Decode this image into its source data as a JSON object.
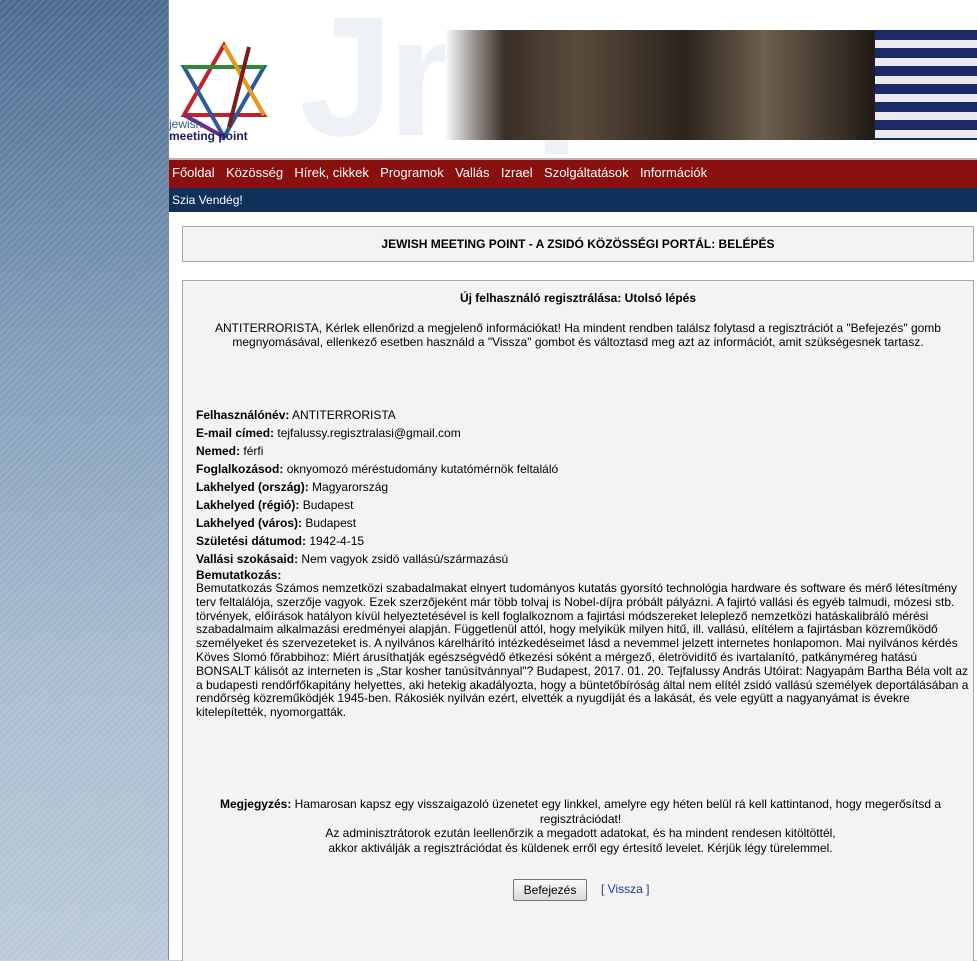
{
  "logo": {
    "line1": "jewish",
    "line2": "meeting point"
  },
  "nav": [
    "Főoldal",
    "Közösség",
    "Hírek, cikkek",
    "Programok",
    "Vallás",
    "Izrael",
    "Szolgáltatások",
    "Információk"
  ],
  "greeting": "Szia Vendég!",
  "page_title": "JEWISH MEETING POINT - A ZSIDÓ KÖZÖSSÉGI PORTÁL: BELÉPÉS",
  "step_title": "Új felhasználó regisztrálása: Utolsó lépés",
  "intro": "ANTITERRORISTA, Kérlek ellenőrizd a megjelenő információkat! Ha mindent rendben találsz folytasd a regisztrációt a \"Befejezés\" gomb megnyomásával, ellenkező esetben használd a \"Vissza\" gombot és változtasd meg azt az információt, amit szükségesnek tartasz.",
  "fields": [
    {
      "label": "Felhasználónév:",
      "value": "ANTITERRORISTA"
    },
    {
      "label": "E-mail címed:",
      "value": "tejfalussy.regisztralasi@gmail.com"
    },
    {
      "label": "Nemed:",
      "value": "férfi"
    },
    {
      "label": "Foglalkozásod:",
      "value": "oknyomozó méréstudomány kutatómérnök feltaláló"
    },
    {
      "label": "Lakhelyed (ország):",
      "value": "Magyarország"
    },
    {
      "label": "Lakhelyed (régió):",
      "value": "Budapest"
    },
    {
      "label": "Lakhelyed (város):",
      "value": "Budapest"
    },
    {
      "label": "Születési dátumod:",
      "value": "1942-4-15"
    },
    {
      "label": "Vallási szokásaid:",
      "value": "Nem vagyok zsidó vallású/származású"
    }
  ],
  "bio_label": "Bemutatkozás:",
  "bio": "Bemutatkozás Számos nemzetközi szabadalmakat elnyert tudományos kutatás gyorsító technológia hardware és software és mérő létesítmény terv feltalálója, szerzője vagyok. Ezek szerzőjeként már több tolvaj is Nobel-díjra próbált pályázni. A fajirtó vallási és egyéb talmudi, mózesi stb. törvények, előírások hatályon kívül helyeztetésével is kell foglalkoznom a fajirtási módszereket leleplező nemzetközi hatáskalibráló mérési szabadalmaim alkalmazási eredményei alapján. Függetlenül attól, hogy melyikük milyen hitű, ill. vallású, elítélem a fajirtásban közreműködő személyeket és szervezeteket is. A nyilvános kárelhárító intézkedéseimet lásd a nevemmel jelzett internetes honlapomon. Mai nyilvános kérdés Köves Slomó főrabbihoz: Miért árusíthatják egészségvédő étkezési sóként a mérgező, életrövidítő és ivartalanító, patkányméreg hatású BONSALT kálisót az interneten is „Star kosher tanúsítvánnyal\"? Budapest, 2017. 01. 20. Tejfalussy András Utóirat: Nagyapám Bartha Béla volt az a budapesti rendőrfőkapitány helyettes, aki hetekig akadályozta, hogy a büntetőbíróság által nem elítél zsidó vallású személyek deportálásában a rendőrség közreműködjék 1945-ben. Rákosiék nyilván ezért, elvették a nyugdíját és a lakását, és vele együtt a nagyanyámat is évekre kitelepítették, nyomorgatták.",
  "note": {
    "label": "Megjegyzés:",
    "line1": " Hamarosan kapsz egy visszaigazoló üzenetet egy linkkel, amelyre egy héten belül rá kell kattintanod, hogy megerősítsd a regisztrációdat!",
    "line2": "Az adminisztrátorok ezután leellenőrzik a megadott adatokat, és ha mindent rendesen kitöltöttél,",
    "line3": "akkor aktiválják a regisztrációdat és küldenek erről egy értesítő levelet. Kérjük légy türelemmel."
  },
  "buttons": {
    "finish": "Befejezés",
    "back_open": "[ ",
    "back": "Vissza",
    "back_close": " ]"
  },
  "colors": {
    "nav_bg": "#8a0f0f",
    "greet_bg": "#10305c",
    "link": "#1b3c8c"
  }
}
